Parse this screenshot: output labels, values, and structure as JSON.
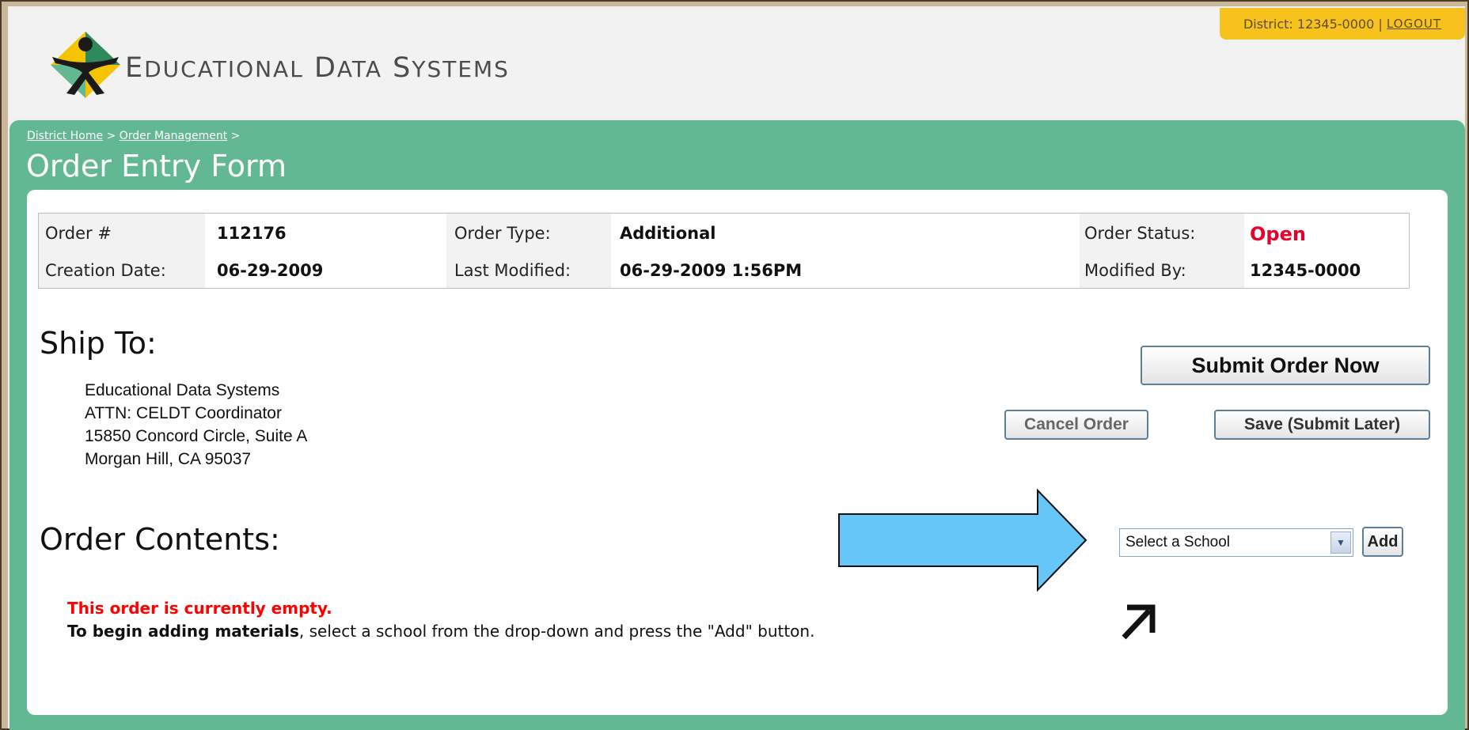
{
  "header": {
    "logo_text_first": "E",
    "logo_text_rest": "DUCATIONAL",
    "logo_text_second_first": "D",
    "logo_text_second_rest": "ATA",
    "logo_text_third_first": "S",
    "logo_text_third_rest": "YSTEMS",
    "district_label": "District: 12345-0000",
    "separator": "|",
    "logout_label": "LOGOUT"
  },
  "breadcrumb": {
    "home": "District Home",
    "sep1": ">",
    "order_management": "Order Management",
    "sep2": ">"
  },
  "page_title": "Order Entry Form",
  "order_info": {
    "order_num_label": "Order #",
    "order_num": "112176",
    "order_type_label": "Order Type:",
    "order_type": "Additional",
    "order_status_label": "Order Status:",
    "order_status": "Open",
    "creation_date_label": "Creation Date:",
    "creation_date": "06-29-2009",
    "last_modified_label": "Last Modified:",
    "last_modified": "06-29-2009 1:56PM",
    "modified_by_label": "Modified By:",
    "modified_by": "12345-0000"
  },
  "ship_to": {
    "title": "Ship To:",
    "lines": [
      "Educational Data Systems",
      "ATTN: CELDT Coordinator",
      "15850 Concord Circle, Suite A",
      "Morgan Hill, CA 95037"
    ]
  },
  "actions": {
    "submit_label": "Submit Order Now",
    "cancel_label": "Cancel Order",
    "save_label": "Save (Submit Later)"
  },
  "order_contents": {
    "title": "Order Contents:",
    "select_value": "Select a School",
    "add_label": "Add",
    "empty_message": "This order is currently empty.",
    "instruction_bold": "To begin adding materials",
    "instruction_rest": ", select a school from the drop-down and press the \"Add\" button."
  },
  "colors": {
    "green": "#62b892",
    "district_tab": "#f8c21c",
    "status_open": "#e8002b",
    "arrow_fill": "#66c6f8"
  }
}
